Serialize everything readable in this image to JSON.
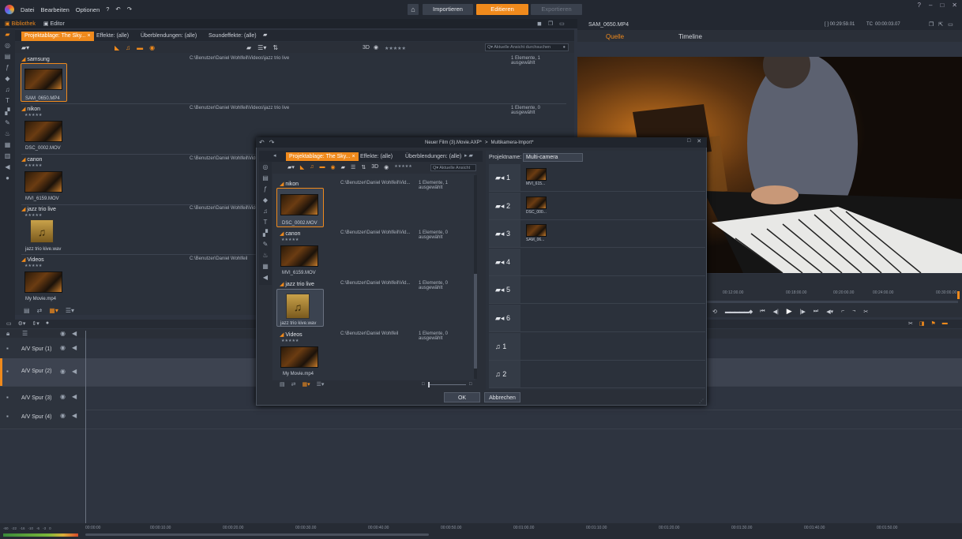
{
  "menu": {
    "items": [
      "Datei",
      "Bearbeiten",
      "Optionen"
    ]
  },
  "top_nav": {
    "import_label": "Importieren",
    "edit_label": "Editieren",
    "export_label": "Exportieren"
  },
  "secondary_tabs": {
    "library_label": "Bibliothek",
    "editor_label": "Editor"
  },
  "library": {
    "tabs": [
      "Projektablage: The Sky...",
      "Effekte: (alle)",
      "Überblendungen: (alle)",
      "Soundeffekte: (alle)"
    ],
    "threed_label": "3D",
    "stars": "★★★★★",
    "search_placeholder": "Aktuelle Ansicht durchsuchen",
    "bins": [
      {
        "name": "samsung",
        "path": "C:\\Benutzer\\Daniel Wohlfeil\\Videos\\jazz trio live",
        "count": "1 Elemente, 1 ausgewählt",
        "item": "SAM_0650.MP4"
      },
      {
        "name": "nikon",
        "path": "C:\\Benutzer\\Daniel Wohlfeil\\Videos\\jazz trio live",
        "count": "1 Elemente, 0 ausgewählt",
        "item": "DSC_0002.MOV"
      },
      {
        "name": "canon",
        "path": "C:\\Benutzer\\Daniel Wohlfeil\\Videos\\jazz trio live",
        "count": "1 Elemente, 0 ausgewählt",
        "item": "MVI_6159.MOV"
      },
      {
        "name": "jazz trio live",
        "path": "C:\\Benutzer\\Daniel Wohlfeil\\Videos\\jazz trio live",
        "count": "1 Elemente, 0 ausgewählt",
        "item": "jazz trio kive.wav"
      },
      {
        "name": "Videos",
        "path": "C:\\Benutzer\\Daniel Wohlfeil\\Videos\\jazz trio live",
        "count": "1 Elemente, 0 ausgewählt",
        "item": "My Movie.mp4"
      }
    ],
    "bins_path_last": "C:\\Benutzer\\Daniel Wohlfeil"
  },
  "preview": {
    "filename": "SAM_0650.MP4",
    "timecode": "[ ] 00:29:59.01",
    "tc_label": "TC",
    "tc_value": "00:00:03.07",
    "tab_source": "Quelle",
    "tab_timeline": "Timeline",
    "ruler": [
      "00:12:00.00",
      "00:18:00.00",
      "00:20:00.00",
      "00:24:00.00",
      "00:30:00.00"
    ]
  },
  "timeline": {
    "tracks": [
      "A/V Spur (1)",
      "A/V Spur (2)",
      "A/V Spur (3)",
      "A/V Spur (4)"
    ],
    "ruler": [
      "00:00:00",
      "00:00:10.00",
      "00:00:20.00",
      "00:00:30.00",
      "00:00:40.00",
      "00:00:50.00",
      "00:01:00.00",
      "00:01:10.00",
      "00:01:20.00",
      "00:01:30.00",
      "00:01:40.00",
      "00:01:50.00"
    ],
    "meter_labels": [
      "-60",
      "-22",
      "-16",
      "-10",
      "-6",
      "-3",
      "0"
    ]
  },
  "dialog": {
    "breadcrumb_film": "Neuer Film (3).Movie.AXP*",
    "breadcrumb_sep": ">",
    "breadcrumb_page": "Multikamera-Import*",
    "tabs": [
      "Projektablage: The Sky...",
      "Effekte: (alle)",
      "Überblendungen: (alle)"
    ],
    "threed_label": "3D",
    "stars": "★★★★★",
    "search_placeholder": "Aktuelle Ansicht",
    "bins": [
      {
        "name": "nikon",
        "path": "C:\\Benutzer\\Daniel Wohlfeil\\Vid...",
        "count": "1 Elemente, 1 ausgewählt",
        "item": "DSC_0002.MOV"
      },
      {
        "name": "canon",
        "path": "C:\\Benutzer\\Daniel Wohlfeil\\Vid...",
        "count": "1 Elemente, 0 ausgewählt",
        "item": "MVI_6159.MOV"
      },
      {
        "name": "jazz trio live",
        "path": "C:\\Benutzer\\Daniel Wohlfeil\\Vid...",
        "count": "1 Elemente, 0 ausgewählt",
        "item": "jazz trio kive.wav"
      },
      {
        "name": "Videos",
        "path": "C:\\Benutzer\\Daniel Wohlfeil",
        "count": "1 Elemente, 0 ausgewählt",
        "item": "My Movie.mp4"
      }
    ],
    "project_name_label": "Projektname:",
    "project_name_value": "Multi-camera",
    "cameras": [
      {
        "num": "1",
        "clip": "MVI_615..."
      },
      {
        "num": "2",
        "clip": "DSC_000..."
      },
      {
        "num": "3",
        "clip": "SAM_06..."
      },
      {
        "num": "4",
        "clip": ""
      },
      {
        "num": "5",
        "clip": ""
      },
      {
        "num": "6",
        "clip": ""
      }
    ],
    "audio": [
      {
        "num": "1"
      },
      {
        "num": "2"
      }
    ],
    "ok_label": "OK",
    "cancel_label": "Abbrechen"
  },
  "colors": {
    "accent": "#f08a1c"
  }
}
